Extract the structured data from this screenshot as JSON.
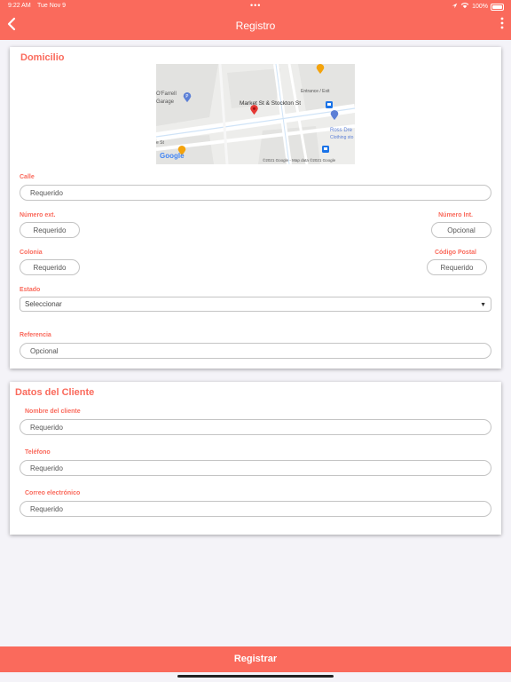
{
  "status_bar": {
    "time": "9:22 AM",
    "date": "Tue Nov 9",
    "battery": "100%"
  },
  "nav": {
    "title": "Registro",
    "back_icon": "chevron-left-icon",
    "more_icon": "more-vertical-icon"
  },
  "domicilio": {
    "title": "Domicilio",
    "map": {
      "labels": [
        "O'Farrell",
        "Garage",
        "Entrance / Exit",
        "Market St & Stockton St",
        "Ross Dre",
        "Clothing sto",
        "e St",
        "©2021 Google - Map data ©2021 Google",
        "Google"
      ]
    },
    "calle": {
      "label": "Calle",
      "placeholder": "Requerido"
    },
    "numero_ext": {
      "label": "Número ext.",
      "placeholder": "Requerido"
    },
    "numero_int": {
      "label": "Número Int.",
      "placeholder": "Opcional"
    },
    "colonia": {
      "label": "Colonia",
      "placeholder": "Requerido"
    },
    "codigo_postal": {
      "label": "Código Postal",
      "placeholder": "Requerido"
    },
    "estado": {
      "label": "Estado",
      "value": "Seleccionar"
    },
    "referencia": {
      "label": "Referencia",
      "placeholder": "Opcional"
    }
  },
  "cliente": {
    "title": "Datos del Cliente",
    "nombre": {
      "label": "Nombre del cliente",
      "placeholder": "Requerido"
    },
    "telefono": {
      "label": "Teléfono",
      "placeholder": "Requerido"
    },
    "correo": {
      "label": "Correo electrónico",
      "placeholder": "Requerido"
    }
  },
  "submit": {
    "label": "Registrar"
  },
  "colors": {
    "accent": "#fa6a5c",
    "background": "#f4f3f8"
  }
}
